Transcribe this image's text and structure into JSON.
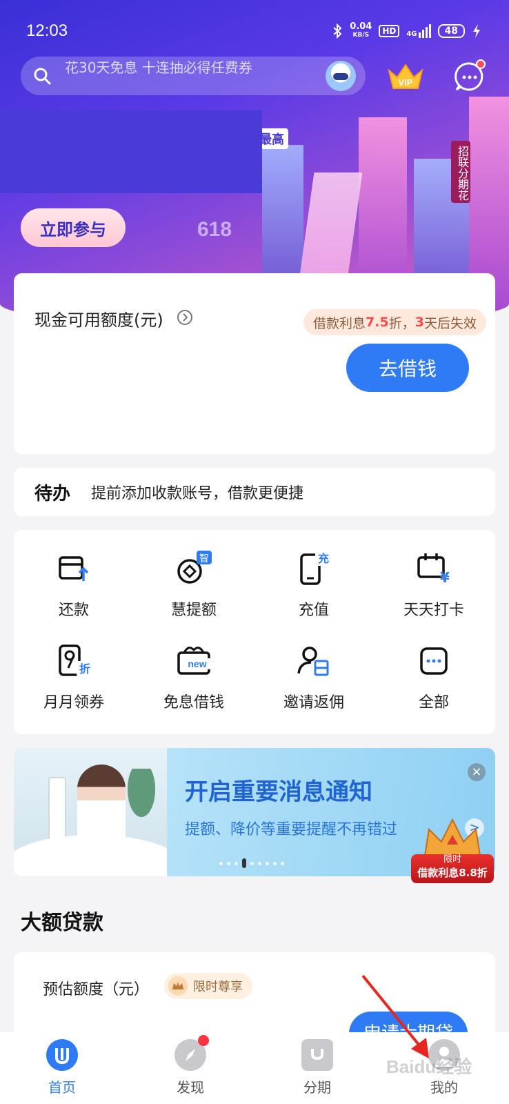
{
  "status_bar": {
    "time": "12:03",
    "net_speed": "0.04",
    "net_unit": "KB/S",
    "hd": "HD",
    "signal": "4G",
    "battery": "48"
  },
  "search": {
    "placeholder": "花30天免息 十连抽必得任费券"
  },
  "hero": {
    "tag": "最高",
    "cta": "立即参与",
    "badge_618": "618",
    "side_sign": "招联分期花"
  },
  "cash_card": {
    "label": "现金可用额度(元)",
    "promo_prefix": "借款利息",
    "promo_rate": "7.5",
    "promo_mid": "折，",
    "promo_days": "3",
    "promo_suffix": "天后失效",
    "borrow_button": "去借钱"
  },
  "todo": {
    "title": "待办",
    "text": "提前添加收款账号，借款更便捷"
  },
  "grid": {
    "items": [
      {
        "label": "还款",
        "icon": "repay-icon"
      },
      {
        "label": "慧提额",
        "icon": "smart-raise-icon",
        "badge": "智"
      },
      {
        "label": "充值",
        "icon": "recharge-icon",
        "badge": "充"
      },
      {
        "label": "天天打卡",
        "icon": "checkin-icon"
      },
      {
        "label": "月月领券",
        "icon": "coupon-icon",
        "badge": "折"
      },
      {
        "label": "免息借钱",
        "icon": "interest-free-icon",
        "badge": "new"
      },
      {
        "label": "邀请返佣",
        "icon": "invite-icon"
      },
      {
        "label": "全部",
        "icon": "more-icon"
      }
    ]
  },
  "banner": {
    "title": "开启重要消息通知",
    "subtitle": "提额、降价等重要提醒不再错过",
    "close": "×",
    "arrow": ">",
    "crown_line1": "限时",
    "crown_line2": "借款利息8.8折"
  },
  "big_loan": {
    "section_title": "大额贷款",
    "label": "预估额度（元）",
    "chip": "限时尊享",
    "apply_button": "申请大期贷"
  },
  "tabbar": {
    "items": [
      {
        "label": "首页",
        "active": true
      },
      {
        "label": "发现",
        "active": false
      },
      {
        "label": "分期",
        "active": false
      },
      {
        "label": "我的",
        "active": false
      }
    ]
  },
  "watermark": "Baidu经验",
  "colors": {
    "primary": "#2f7bf6",
    "promo_red": "#ff4a4a",
    "hero_start": "#3a2fd6",
    "hero_end": "#e89ad8"
  }
}
